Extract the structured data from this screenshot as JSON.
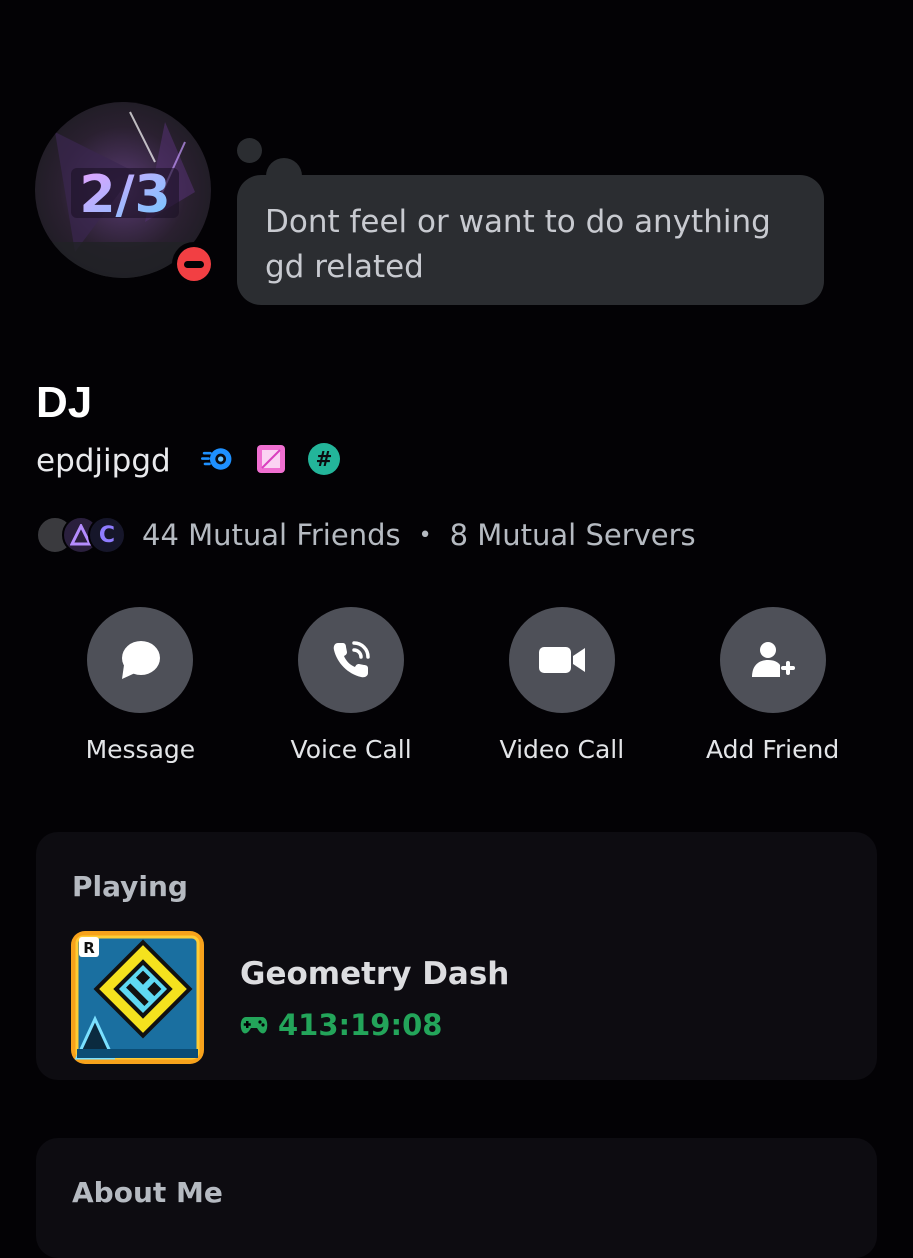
{
  "profile": {
    "display_name": "DJ",
    "username": "epdjipgd",
    "status": "Do Not Disturb",
    "custom_status": "Dont feel or want to do anything gd related",
    "badges": [
      "nitro-boost-icon",
      "crystal-icon",
      "hashtag-badge-icon"
    ]
  },
  "mutuals": {
    "friends": "44 Mutual Friends",
    "separator": "•",
    "servers": "8 Mutual Servers",
    "letter": "C"
  },
  "actions": [
    {
      "label": "Message",
      "icon": "message-icon"
    },
    {
      "label": "Voice Call",
      "icon": "phone-icon"
    },
    {
      "label": "Video Call",
      "icon": "video-camera-icon"
    },
    {
      "label": "Add Friend",
      "icon": "add-friend-icon"
    }
  ],
  "activity": {
    "heading": "Playing",
    "game": "Geometry Dash",
    "elapsed": "413:19:08",
    "badge_letter": "R"
  },
  "about": {
    "heading": "About Me"
  },
  "colors": {
    "background": "#030205",
    "card": "#0d0c11",
    "bubble": "#2b2d31",
    "dnd": "#f23f43",
    "playing_green": "#23a55a",
    "action_circle": "#4e5058"
  }
}
